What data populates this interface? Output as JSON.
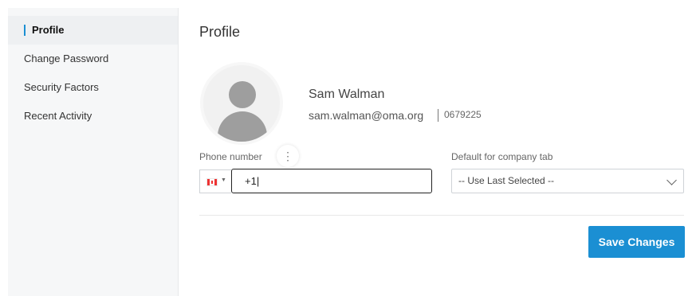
{
  "sidebar": {
    "items": [
      {
        "label": "Profile",
        "active": true
      },
      {
        "label": "Change Password",
        "active": false
      },
      {
        "label": "Security Factors",
        "active": false
      },
      {
        "label": "Recent Activity",
        "active": false
      }
    ]
  },
  "profile": {
    "title": "Profile",
    "name": "Sam Walman",
    "email": "sam.walman@oma.org",
    "id": "0679225",
    "avatar_menu_icon": "⋮"
  },
  "form": {
    "phone_label": "Phone number",
    "phone_value": "+1|",
    "country_icon": "canada-flag-icon",
    "default_tab_label": "Default for company tab",
    "default_tab_value": "-- Use Last Selected --",
    "save_label": "Save Changes"
  },
  "colors": {
    "accent": "#1b8fd3",
    "sidebar_bg": "#f6f7f8"
  }
}
